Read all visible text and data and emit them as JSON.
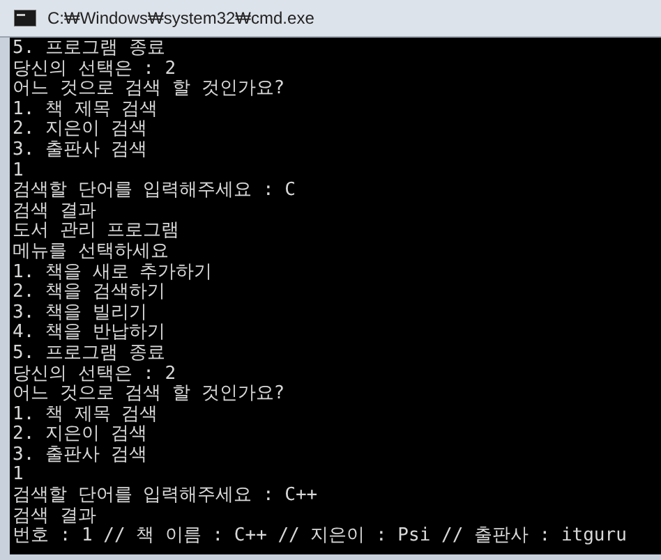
{
  "window": {
    "title": "C:₩Windows₩system32₩cmd.exe"
  },
  "console_lines": [
    "5. 프로그램 종료",
    "당신의 선택은 : 2",
    "어느 것으로 검색 할 것인가요?",
    "1. 책 제목 검색",
    "2. 지은이 검색",
    "3. 출판사 검색",
    "1",
    "검색할 단어를 입력해주세요 : C",
    "검색 결과",
    "도서 관리 프로그램",
    "메뉴를 선택하세요",
    "1. 책을 새로 추가하기",
    "2. 책을 검색하기",
    "3. 책을 빌리기",
    "4. 책을 반납하기",
    "5. 프로그램 종료",
    "당신의 선택은 : 2",
    "어느 것으로 검색 할 것인가요?",
    "1. 책 제목 검색",
    "2. 지은이 검색",
    "3. 출판사 검색",
    "1",
    "검색할 단어를 입력해주세요 : C++",
    "검색 결과",
    "번호 : 1 // 책 이름 : C++ // 지은이 : Psi // 출판사 : itguru"
  ]
}
